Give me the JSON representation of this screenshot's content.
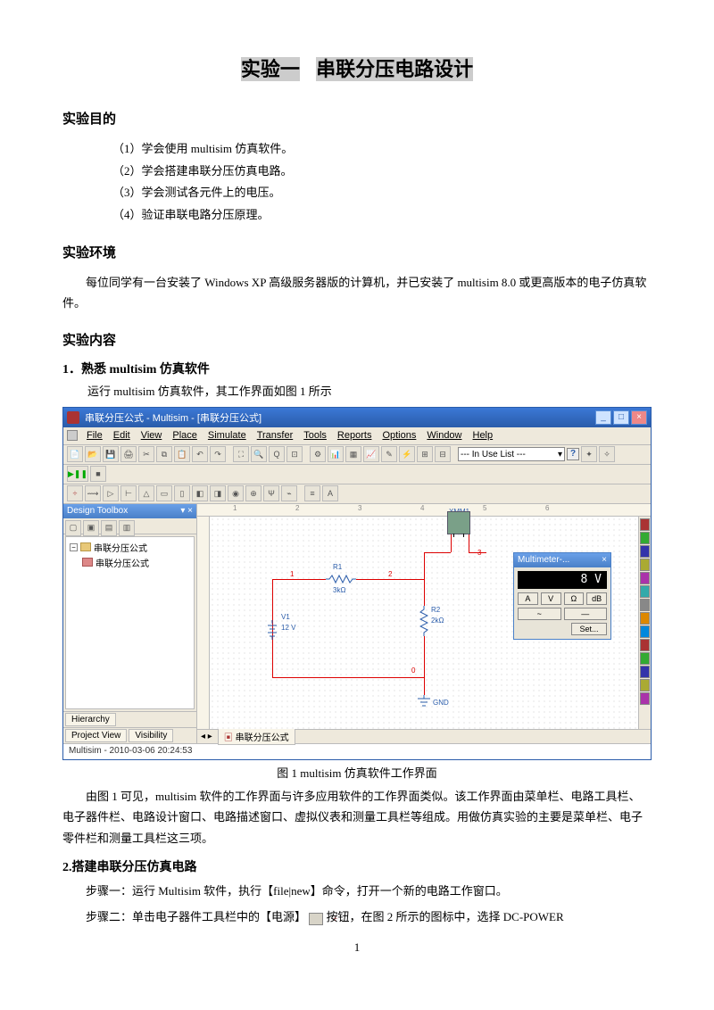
{
  "title_part1": "实验一",
  "title_part2": "串联分压电路设计",
  "sec_objective": "实验目的",
  "objectives": [
    "（1）学会使用 multisim 仿真软件。",
    "（2）学会搭建串联分压仿真电路。",
    "（3）学会测试各元件上的电压。",
    "（4）验证串联电路分压原理。"
  ],
  "sec_env": "实验环境",
  "env_para": "每位同学有一台安装了 Windows XP 高级服务器版的计算机，并已安装了 multisim 8.0 或更高版本的电子仿真软件。",
  "sec_content": "实验内容",
  "step1_h": "1．熟悉 multisim 仿真软件",
  "step1_p": "运行 multisim 仿真软件，其工作界面如图 1 所示",
  "caption1": "图 1 multisim 仿真软件工作界面",
  "para_after1": "由图 1 可见，multisim 软件的工作界面与许多应用软件的工作界面类似。该工作界面由菜单栏、电路工具栏、电子器件栏、电路设计窗口、电路描述窗口、虚拟仪表和测量工具栏等组成。用做仿真实验的主要是菜单栏、电子零件栏和测量工具栏这三项。",
  "step2_h": "2.搭建串联分压仿真电路",
  "step2_p1a": "步骤一：运行 Multisim 软件，执行【file|new】命令，打开一个新的电路工作窗口。",
  "step2_p2a": "步骤二：单击电子器件工具栏中的【电源】",
  "step2_p2b": "按钮，在图 2 所示的图标中，选择 DC-POWER",
  "page_num": "1",
  "ms": {
    "title": "串联分压公式 - Multisim - [串联分压公式]",
    "menus": [
      "File",
      "Edit",
      "View",
      "Place",
      "Simulate",
      "Transfer",
      "Tools",
      "Reports",
      "Options",
      "Window",
      "Help"
    ],
    "inuse": "--- In Use List ---",
    "design_toolbox": "Design Toolbox",
    "tree_root": "串联分压公式",
    "tree_child": "串联分压公式",
    "bottom_tabs": [
      "Hierarchy",
      "Project View",
      "Visibility"
    ],
    "canvas_tab": "串联分压公式",
    "status": "Multisim - 2010-03-06 20:24:53",
    "ruler_marks": [
      "1",
      "2",
      "3",
      "4",
      "5",
      "6"
    ],
    "circuit": {
      "xmm_label": "XMM1",
      "r1": "R1",
      "r1_val": "3kΩ",
      "r2": "R2",
      "r2_val": "2kΩ",
      "v1": "V1",
      "v1_val": "12 V",
      "gnd": "GND",
      "nodes": {
        "n1": "1",
        "n2": "2",
        "n3": "3",
        "n0": "0"
      }
    },
    "multimeter": {
      "title": "Multimeter-...",
      "reading": "8 V",
      "row1": [
        "A",
        "V",
        "Ω",
        "dB"
      ],
      "row2": [
        "~",
        "—",
        "+",
        "⎓"
      ],
      "set": "Set..."
    }
  }
}
